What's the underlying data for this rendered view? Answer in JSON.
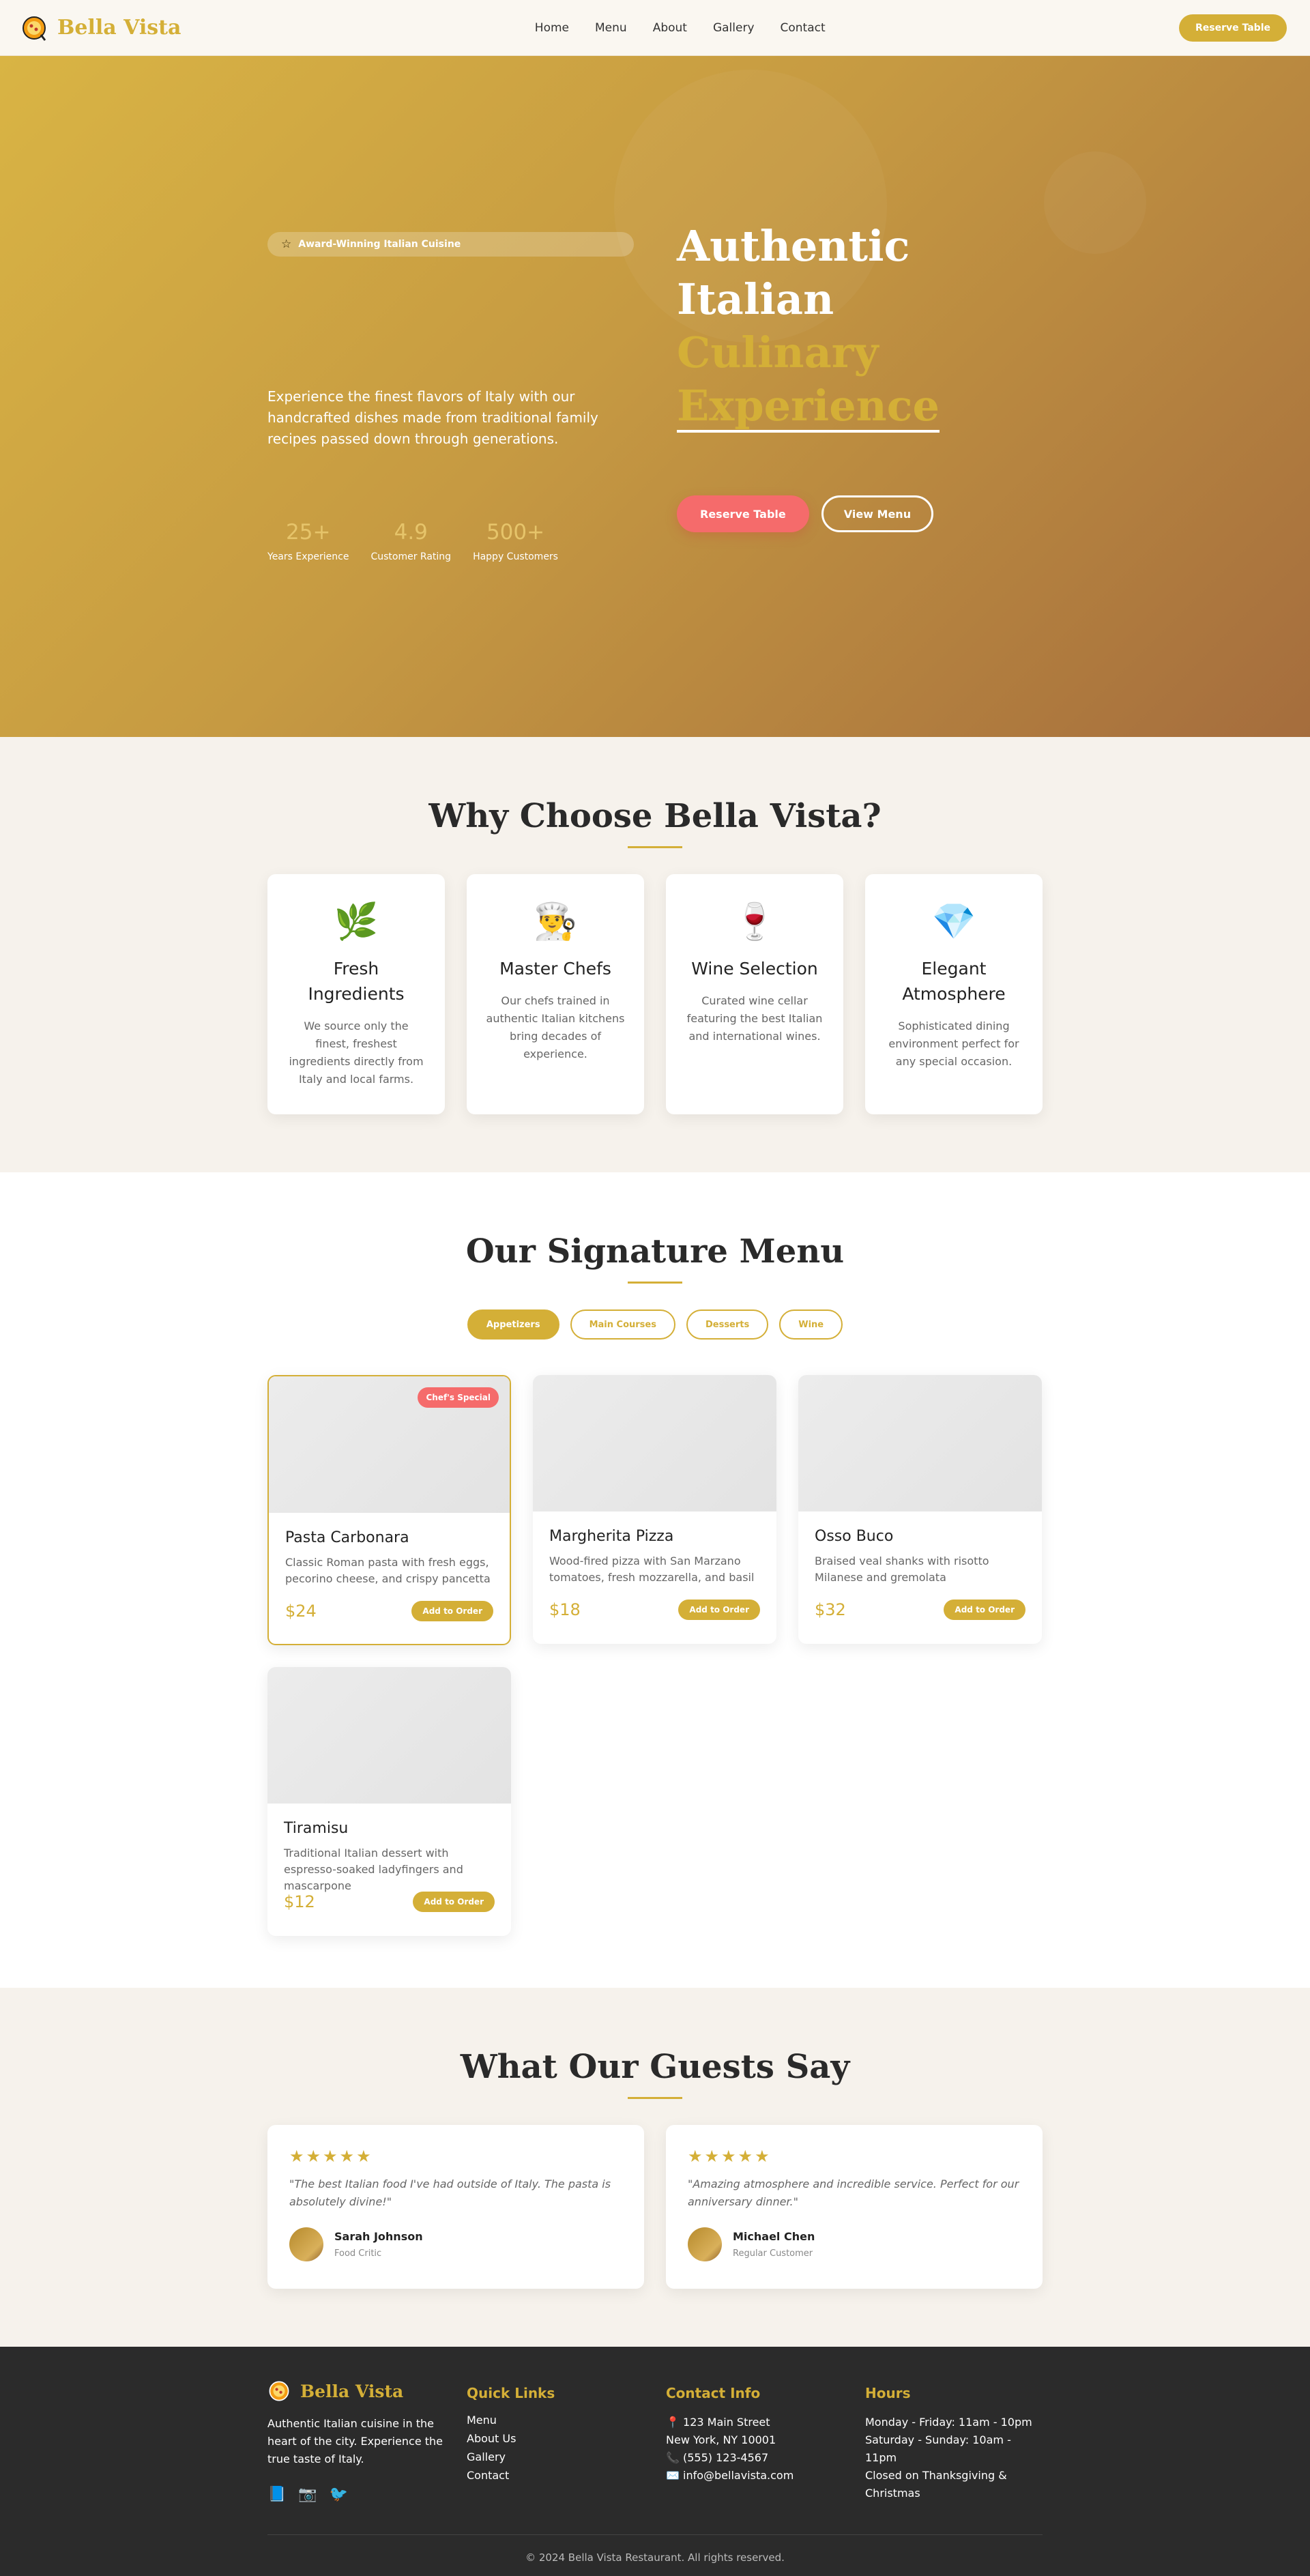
{
  "nav": {
    "brand": "Bella Vista",
    "links": [
      "Home",
      "Menu",
      "About",
      "Gallery",
      "Contact"
    ],
    "cta": "Reserve Table"
  },
  "hero": {
    "badge": "Award-Winning Italian Cuisine",
    "description": "Experience the finest flavors of Italy with our handcrafted dishes made from traditional family recipes passed down through generations.",
    "stats": [
      {
        "num": "25+",
        "label": "Years Experience"
      },
      {
        "num": "4.9",
        "label": "Customer Rating"
      },
      {
        "num": "500+",
        "label": "Happy Customers"
      }
    ],
    "title_line1": "Authentic Italian",
    "title_line2": "Culinary",
    "title_line3": "Experience",
    "btn_reserve": "Reserve Table",
    "btn_menu": "View Menu"
  },
  "why": {
    "title": "Why Choose Bella Vista?",
    "features": [
      {
        "icon": "🌿",
        "title": "Fresh Ingredients",
        "desc": "We source only the finest, freshest ingredients directly from Italy and local farms."
      },
      {
        "icon": "👨‍🍳",
        "title": "Master Chefs",
        "desc": "Our chefs trained in authentic Italian kitchens bring decades of experience."
      },
      {
        "icon": "🍷",
        "title": "Wine Selection",
        "desc": "Curated wine cellar featuring the best Italian and international wines."
      },
      {
        "icon": "💎",
        "title": "Elegant Atmosphere",
        "desc": "Sophisticated dining environment perfect for any special occasion."
      }
    ]
  },
  "menu": {
    "title": "Our Signature Menu",
    "filters": [
      "Appetizers",
      "Main Courses",
      "Desserts",
      "Wine"
    ],
    "badge": "Chef's Special",
    "add_label": "Add to Order",
    "items": [
      {
        "name": "Pasta Carbonara",
        "desc": "Classic Roman pasta with fresh eggs, pecorino cheese, and crispy pancetta",
        "price": "$24"
      },
      {
        "name": "Margherita Pizza",
        "desc": "Wood-fired pizza with San Marzano tomatoes, fresh mozzarella, and basil",
        "price": "$18"
      },
      {
        "name": "Osso Buco",
        "desc": "Braised veal shanks with risotto Milanese and gremolata",
        "price": "$32"
      },
      {
        "name": "Tiramisu",
        "desc": "Traditional Italian dessert with espresso-soaked ladyfingers and mascarpone",
        "price": "$12"
      }
    ]
  },
  "testimonials": {
    "title": "What Our Guests Say",
    "stars": "★★★★★",
    "items": [
      {
        "quote": "\"The best Italian food I've had outside of Italy. The pasta is absolutely divine!\"",
        "name": "Sarah Johnson",
        "role": "Food Critic"
      },
      {
        "quote": "\"Amazing atmosphere and incredible service. Perfect for our anniversary dinner.\"",
        "name": "Michael Chen",
        "role": "Regular Customer"
      }
    ]
  },
  "footer": {
    "brand": "Bella Vista",
    "about": "Authentic Italian cuisine in the heart of the city. Experience the true taste of Italy.",
    "social_icons": [
      "📘",
      "📷",
      "🐦"
    ],
    "quick_links_title": "Quick Links",
    "quick_links": [
      "Menu",
      "About Us",
      "Gallery",
      "Contact"
    ],
    "contact_title": "Contact Info",
    "contact": [
      "📍 123 Main Street",
      "New York, NY 10001",
      "📞 (555) 123-4567",
      "✉️ info@bellavista.com"
    ],
    "hours_title": "Hours",
    "hours": [
      "Monday - Friday: 11am - 10pm",
      "Saturday - Sunday: 10am - 11pm",
      "Closed on Thanksgiving & Christmas"
    ],
    "copyright": "© 2024 Bella Vista Restaurant. All rights reserved."
  },
  "colors": {
    "gold": "#d4af37",
    "coral": "#f56b6b",
    "dark": "#2b2b2b"
  }
}
